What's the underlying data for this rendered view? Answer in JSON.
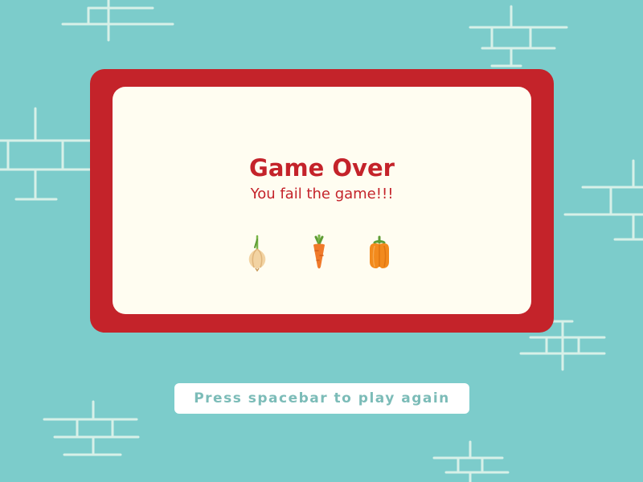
{
  "dialog": {
    "title": "Game Over",
    "message": "You fail the game!!!",
    "items": [
      {
        "icon": "onion-icon",
        "color": "#f2cf99"
      },
      {
        "icon": "carrot-icon",
        "color": "#f07a2a"
      },
      {
        "icon": "bell-pepper-icon",
        "color": "#f28a1d"
      }
    ]
  },
  "prompt": {
    "label": "Press spacebar to play again"
  },
  "colors": {
    "background": "#7ccccb",
    "frame": "#c4232a",
    "panel": "#fffdf1",
    "brick_lines": "#d7f0e8",
    "prompt_text": "#7cbcb8"
  }
}
